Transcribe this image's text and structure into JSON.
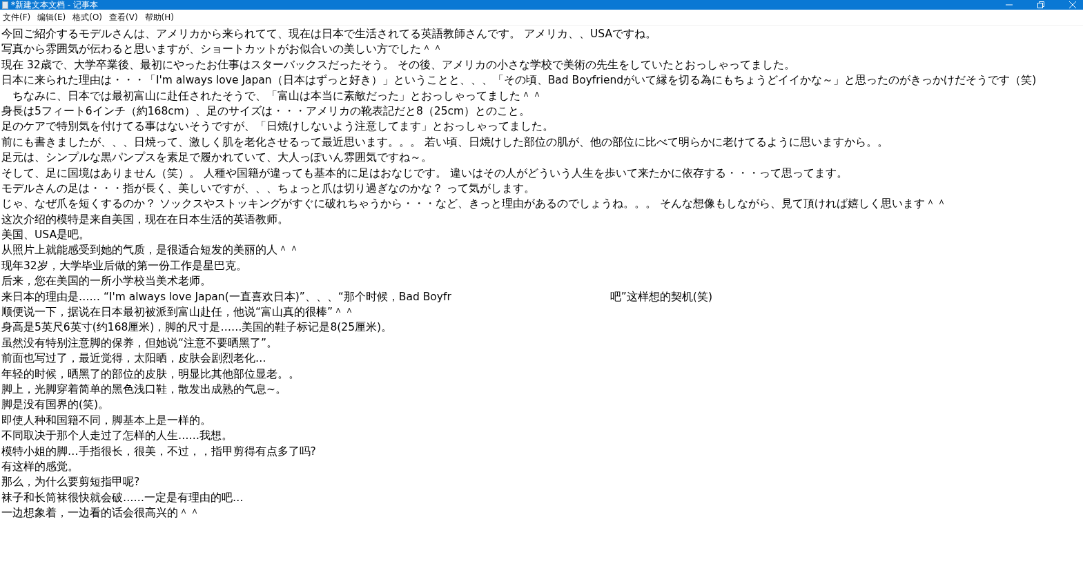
{
  "window": {
    "title": "*新建文本文档 - 记事本"
  },
  "menu": [
    "文件(F)",
    "编辑(E)",
    "格式(O)",
    "查看(V)",
    "帮助(H)"
  ],
  "lines": [
    {
      "kind": "line",
      "text": "今回ご紹介するモデルさんは、アメリカから来られてて、現在は日本で生活されてる英語教師さんです。 アメリカ、、USAですね。"
    },
    {
      "kind": "line",
      "text": "写真から雰囲気が伝わると思いますが、ショートカットがお似合いの美しい方でした＾＾"
    },
    {
      "kind": "line",
      "text": "現在 32歳で、大学卒業後、最初にやったお仕事はスターバックスだったそう。 その後、アメリカの小さな学校で美術の先生をしていたとおっしゃってました。"
    },
    {
      "kind": "line",
      "text": "日本に来られた理由は・・・「I'm always love Japan（日本はずっと好き）」ということと、、、「その頃、Bad Boyfriendがいて縁を切る為にもちょうどイイかな～」と思ったのがきっかけだそうです（笑)"
    },
    {
      "kind": "line",
      "text": "　ちなみに、日本では最初富山に赴任されたそうで、「富山は本当に素敵だった」とおっしゃってました＾＾"
    },
    {
      "kind": "line",
      "text": "身長は5フィート6インチ（約168cm）、足のサイズは・・・アメリカの靴表記だと8（25cm）とのこと。"
    },
    {
      "kind": "line",
      "text": "足のケアで特別気を付けてる事はないそうですが、「日焼けしないよう注意してます」とおっしゃってました。"
    },
    {
      "kind": "line",
      "text": "前にも書きましたが、、、日焼って、激しく肌を老化させるって最近思います。。。 若い頃、日焼けした部位の肌が、他の部位に比べて明らかに老けてるように思いますから。。"
    },
    {
      "kind": "line",
      "text": "足元は、シンプルな黒パンプスを素足で履かれていて、大人っぽいん雰囲気ですね～。"
    },
    {
      "kind": "line",
      "text": "そして、足に国境はありません（笑）。 人種や国籍が違っても基本的に足はおなじです。 違いはその人がどういう人生を歩いて来たかに依存する・・・って思ってます。"
    },
    {
      "kind": "line",
      "text": "モデルさんの足は・・・指が長く、美しいですが、、、ちょっと爪は切り過ぎなのかな？ って気がします。"
    },
    {
      "kind": "line",
      "text": "じゃ、なぜ爪を短くするのか？ ソックスやストッキングがすぐに破れちゃうから・・・など、きっと理由があるのでしょうね。。。 そんな想像もしながら、見て頂ければ嬉しく思います＾＾"
    },
    {
      "kind": "line",
      "text": "这次介绍的模特是来自美国，现在在日本生活的英语教师。"
    },
    {
      "kind": "line",
      "text": "美国、USA是吧。"
    },
    {
      "kind": "line",
      "text": "从照片上就能感受到她的气质，是很适合短发的美丽的人＾＾"
    },
    {
      "kind": "line",
      "text": "现年32岁，大学毕业后做的第一份工作是星巴克。"
    },
    {
      "kind": "line",
      "text": "后来，您在美国的一所小学校当美术老师。"
    },
    {
      "kind": "split",
      "parts": [
        "来日本的理由是…… “I'm always love Japan(一直喜欢日本)”、、、“那个时候，Bad Boyfr",
        "吧”这样想的契机(笑)"
      ]
    },
    {
      "kind": "line",
      "text": "顺便说一下，据说在日本最初被派到富山赴任，他说“富山真的很棒”＾＾"
    },
    {
      "kind": "line",
      "text": "身高是5英尺6英寸(约168厘米)，脚的尺寸是……美国的鞋子标记是8(25厘米)。"
    },
    {
      "kind": "line",
      "text": "虽然没有特别注意脚的保养，但她说“注意不要晒黑了”。"
    },
    {
      "kind": "line",
      "text": "前面也写过了，最近觉得，太阳晒，皮肤会剧烈老化…"
    },
    {
      "kind": "line",
      "text": "年轻的时候，晒黑了的部位的皮肤，明显比其他部位显老。。"
    },
    {
      "kind": "line",
      "text": "脚上，光脚穿着简单的黑色浅口鞋，散发出成熟的气息~。"
    },
    {
      "kind": "line",
      "text": "脚是没有国界的(笑)。"
    },
    {
      "kind": "line",
      "text": "即使人种和国籍不同，脚基本上是一样的。"
    },
    {
      "kind": "line",
      "text": "不同取决于那个人走过了怎样的人生……我想。"
    },
    {
      "kind": "line",
      "text": "模特小姐的脚…手指很长，很美，不过，，指甲剪得有点多了吗?"
    },
    {
      "kind": "line",
      "text": "有这样的感觉。"
    },
    {
      "kind": "line",
      "text": "那么，为什么要剪短指甲呢?"
    },
    {
      "kind": "line",
      "text": "袜子和长筒袜很快就会破……一定是有理由的吧…"
    },
    {
      "kind": "line",
      "text": "一边想象着，一边看的话会很高兴的＾＾"
    }
  ]
}
